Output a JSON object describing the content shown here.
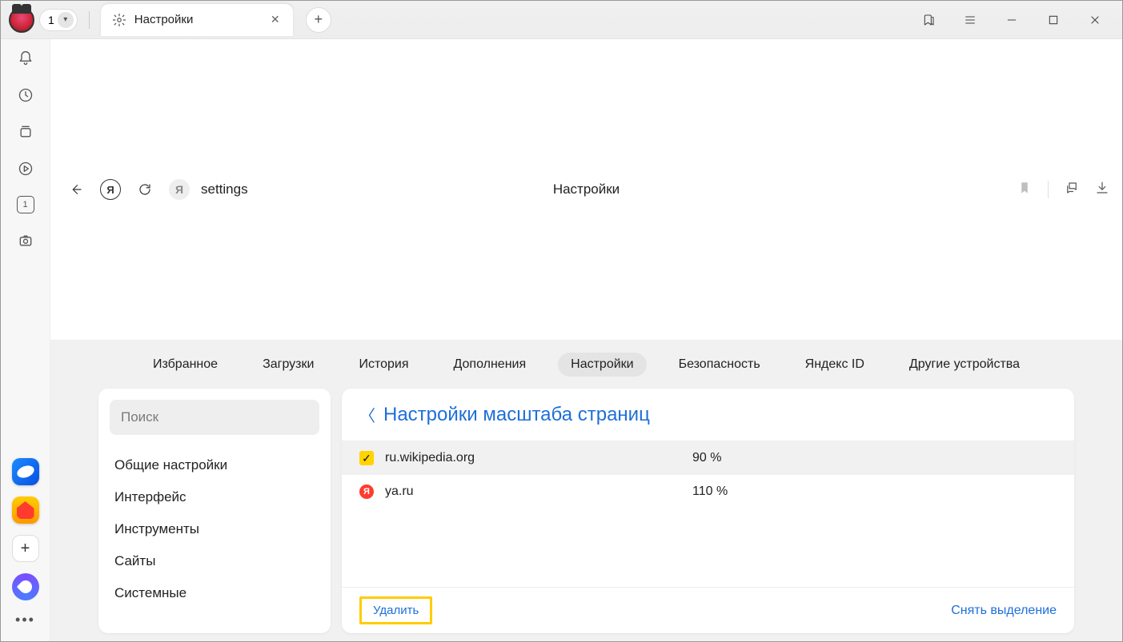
{
  "titlebar": {
    "tab_count": "1",
    "tab_title": "Настройки"
  },
  "addressbar": {
    "url_text": "settings",
    "page_title": "Настройки",
    "yandex_glyph": "Я"
  },
  "prefs_tabs": {
    "items": [
      {
        "label": "Избранное"
      },
      {
        "label": "Загрузки"
      },
      {
        "label": "История"
      },
      {
        "label": "Дополнения"
      },
      {
        "label": "Настройки",
        "active": true
      },
      {
        "label": "Безопасность"
      },
      {
        "label": "Яндекс ID"
      },
      {
        "label": "Другие устройства"
      }
    ]
  },
  "sidebar": {
    "search_placeholder": "Поиск",
    "items": [
      {
        "label": "Общие настройки"
      },
      {
        "label": "Интерфейс"
      },
      {
        "label": "Инструменты"
      },
      {
        "label": "Сайты"
      },
      {
        "label": "Системные"
      }
    ]
  },
  "main": {
    "title": "Настройки масштаба страниц",
    "rows": [
      {
        "domain": "ru.wikipedia.org",
        "zoom": "90 %",
        "checked": true,
        "favicon": "checkbox"
      },
      {
        "domain": "ya.ru",
        "zoom": "110 %",
        "checked": false,
        "favicon": "yandex"
      }
    ],
    "footer": {
      "delete_label": "Удалить",
      "deselect_label": "Снять выделение"
    }
  },
  "left_rail": {
    "tab_counter_badge": "1"
  }
}
